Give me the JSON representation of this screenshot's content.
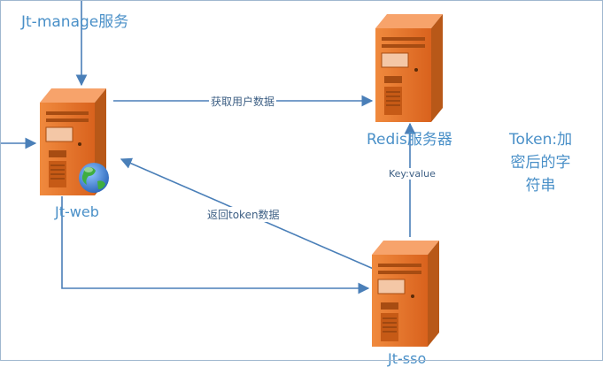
{
  "nodes": {
    "jt_manage": {
      "label": "Jt-manage服务"
    },
    "jt_web": {
      "label": "Jt-web"
    },
    "redis": {
      "label": "Redis服务器"
    },
    "jt_sso": {
      "label": "Jt-sso"
    }
  },
  "edges": {
    "get_user_data": "获取用户数据",
    "return_token": "返回token数据",
    "key_value": "Key:value"
  },
  "note": {
    "line1": "Token:加",
    "line2": "密后的字",
    "line3": "符串"
  },
  "colors": {
    "server_body": "#e8742a",
    "server_side": "#b85818",
    "server_top": "#f7a36b",
    "connector": "#4a7fb8",
    "label_text": "#4a90c8",
    "globe_blue": "#3a7fd6",
    "globe_green": "#3fae3f"
  }
}
